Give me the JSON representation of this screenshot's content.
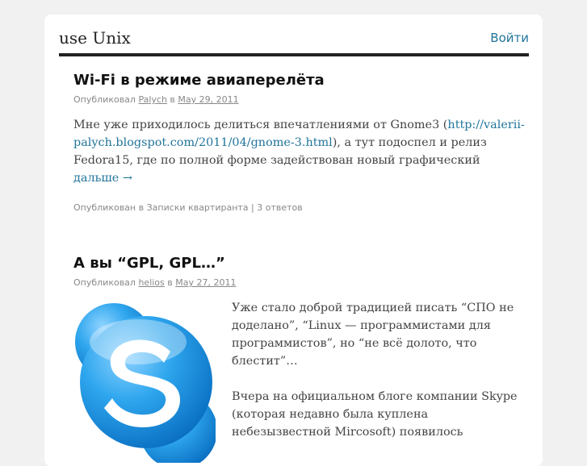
{
  "header": {
    "site_title": "use Unix",
    "login_label": "Войти"
  },
  "posts": [
    {
      "title": "Wi-Fi в режиме авиаперелёта",
      "by_label": "Опубликовал",
      "author": "Palych",
      "in_label": "в",
      "date": "May 29, 2011",
      "excerpt_before": "Мне уже приходилось делиться впечатлениями от Gnome3 (",
      "excerpt_link": "http://valerii-palych.blogspot.com/2011/04/gnome-3.html",
      "excerpt_after": "), а тут подоспел и релиз Fedora15, где по полной форме задействован новый графический",
      "more_label": "дальше →",
      "posted_label": "Опубликован в",
      "category": "Записки квартиранта",
      "separator": "|",
      "comments": "3 ответов"
    },
    {
      "title": "А вы “GPL, GPL…”",
      "by_label": "Опубликовал",
      "author": "helios",
      "in_label": "в",
      "date": "May 27, 2011",
      "paragraph1": "Уже стало доброй традицией писать “СПО не доделано”, “Linux — программистами для программистов”, но “не всё долото, что блестит”…",
      "paragraph2": "Вчера на официальном блоге компании Skype (которая недавно была куплена небезызвестной Mircosoft) появилось"
    }
  ],
  "colors": {
    "link": "#21759b",
    "skype_blue": "#1a9ae0"
  }
}
